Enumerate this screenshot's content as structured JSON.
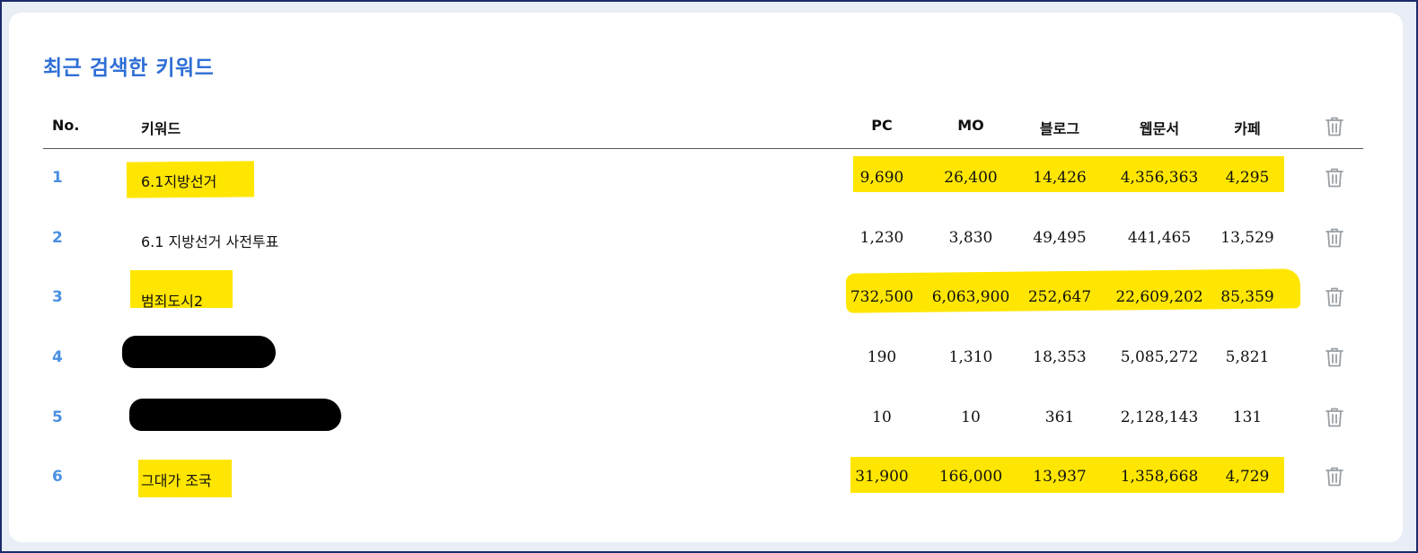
{
  "title": "최근 검색한 키워드",
  "headers": {
    "no": "No.",
    "keyword": "키워드",
    "pc": "PC",
    "mo": "MO",
    "blog": "블로그",
    "web": "웹문서",
    "cafe": "카페"
  },
  "rows": [
    {
      "no": "1",
      "keyword": "6.1지방선거",
      "pc": "9,690",
      "mo": "26,400",
      "blog": "14,426",
      "web": "4,356,363",
      "cafe": "4,295"
    },
    {
      "no": "2",
      "keyword": "6.1 지방선거 사전투표",
      "pc": "1,230",
      "mo": "3,830",
      "blog": "49,495",
      "web": "441,465",
      "cafe": "13,529"
    },
    {
      "no": "3",
      "keyword": "범죄도시2",
      "pc": "732,500",
      "mo": "6,063,900",
      "blog": "252,647",
      "web": "22,609,202",
      "cafe": "85,359"
    },
    {
      "no": "4",
      "keyword": "",
      "pc": "190",
      "mo": "1,310",
      "blog": "18,353",
      "web": "5,085,272",
      "cafe": "5,821"
    },
    {
      "no": "5",
      "keyword": "",
      "pc": "10",
      "mo": "10",
      "blog": "361",
      "web": "2,128,143",
      "cafe": "131"
    },
    {
      "no": "6",
      "keyword": "그대가 조국",
      "pc": "31,900",
      "mo": "166,000",
      "blog": "13,937",
      "web": "1,358,668",
      "cafe": "4,729"
    }
  ],
  "icons": {
    "delete": "trash-icon"
  },
  "colors": {
    "title": "#2f6fd6",
    "row_number": "#4a90e2",
    "highlight": "#ffe600",
    "icon": "#9aa0a6"
  }
}
